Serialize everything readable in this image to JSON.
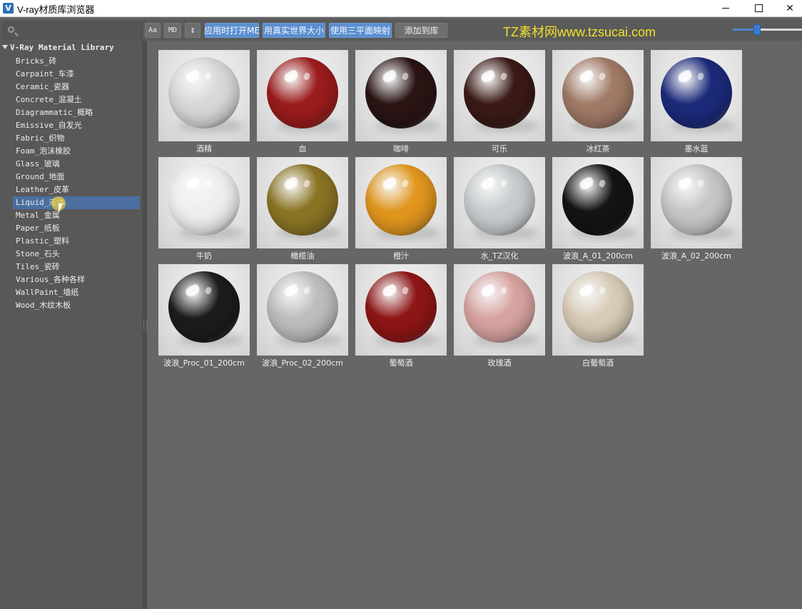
{
  "window": {
    "title": "V-ray材质库浏览器",
    "icon_letter": "V",
    "icon_color": "#2e6fb8",
    "minimize_label": "",
    "maximize_label": "",
    "close_label": "✕"
  },
  "toolbar": {
    "search": {
      "value": "",
      "placeholder": ""
    },
    "buttons": [
      {
        "label": "Aa"
      },
      {
        "label": "MD"
      },
      {
        "label": "↕"
      },
      {
        "label": "应用时打开ME"
      },
      {
        "label": "用真实世界大小"
      },
      {
        "label": "使用三平面映射"
      },
      {
        "label": "添加到库"
      }
    ],
    "watermark": "TZ素材网www.tzsucai.com",
    "zoom_slider": {
      "value": 0.32
    }
  },
  "sidebar": {
    "root_label": "V-Ray Material Library",
    "items": [
      {
        "label": "Bricks_砖"
      },
      {
        "label": "Carpaint_车漆"
      },
      {
        "label": "Ceramic_瓷器"
      },
      {
        "label": "Concrete_混凝土"
      },
      {
        "label": "Diagrammatic_概略"
      },
      {
        "label": "Emissive_自发光"
      },
      {
        "label": "Fabric_织物"
      },
      {
        "label": "Foam_泡沫橡胶"
      },
      {
        "label": "Glass_玻璃"
      },
      {
        "label": "Ground_地面"
      },
      {
        "label": "Leather_皮革"
      },
      {
        "label": "Liquid_液体",
        "selected": true
      },
      {
        "label": "Metal_金属"
      },
      {
        "label": "Paper_纸板"
      },
      {
        "label": "Plastic_塑料"
      },
      {
        "label": "Stone_石头"
      },
      {
        "label": "Tiles_瓷砖"
      },
      {
        "label": "Various_各种各样"
      },
      {
        "label": "WallPaint_墙纸"
      },
      {
        "label": "Wood_木纹木板"
      }
    ],
    "selected_color": "#4a6fa0"
  },
  "materials": [
    {
      "label": "酒精",
      "color": "#d8d8d8"
    },
    {
      "label": "血",
      "color": "#9b1c1c"
    },
    {
      "label": "咖啡",
      "color": "#2a1414"
    },
    {
      "label": "可乐",
      "color": "#3a1a16"
    },
    {
      "label": "冰红茶",
      "color": "#a07a66"
    },
    {
      "label": "墨水蓝",
      "color": "#1c2a7a"
    },
    {
      "label": "牛奶",
      "color": "#eeeeee"
    },
    {
      "label": "橄榄油",
      "color": "#8a7424"
    },
    {
      "label": "橙汁",
      "color": "#e0961e"
    },
    {
      "label": "水_TZ汉化",
      "color": "#c6cbcd"
    },
    {
      "label": "波浪_A_01_200cm",
      "color": "#141414"
    },
    {
      "label": "波浪_A_02_200cm",
      "color": "#c4c6c8"
    },
    {
      "label": "波浪_Proc_01_200cm",
      "color": "#1c1c1c"
    },
    {
      "label": "波浪_Proc_02_200cm",
      "color": "#bdbdbd"
    },
    {
      "label": "葡萄酒",
      "color": "#8e1616"
    },
    {
      "label": "玫瑰酒",
      "color": "#d7a3a0"
    },
    {
      "label": "白葡萄酒",
      "color": "#d8cbb6"
    }
  ]
}
